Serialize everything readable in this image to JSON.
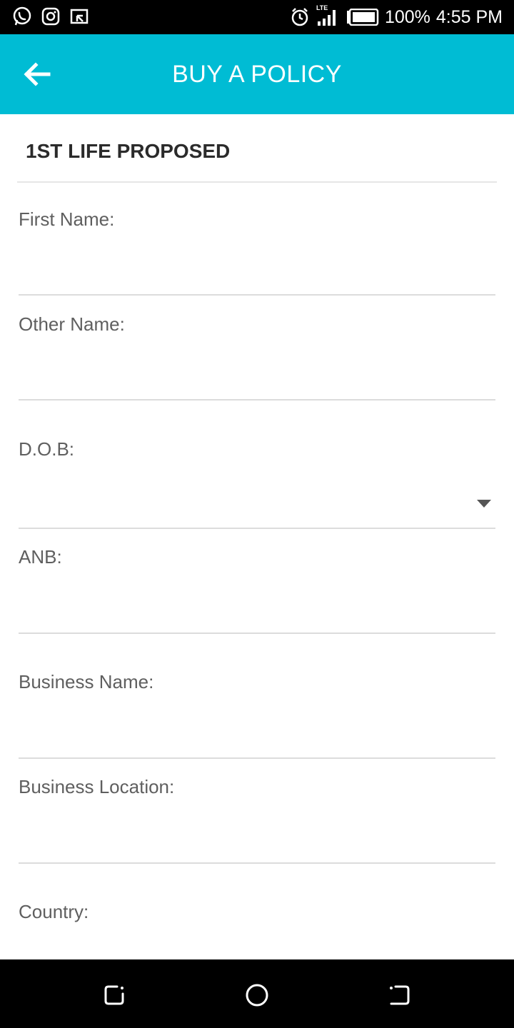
{
  "status_bar": {
    "left_icons": [
      "whatsapp-icon",
      "instagram-icon",
      "cast-icon"
    ],
    "right_icons": [
      "alarm-icon",
      "signal-icon",
      "battery-icon"
    ],
    "network_label": "LTE",
    "battery_percent": "100%",
    "time": "4:55 PM"
  },
  "app_bar": {
    "back_icon": "arrow-left-icon",
    "title": "BUY A POLICY"
  },
  "section": {
    "title": "1ST LIFE PROPOSED"
  },
  "fields": {
    "first_name": {
      "label": "First Name:",
      "value": ""
    },
    "other_name": {
      "label": "Other Name:",
      "value": ""
    },
    "dob": {
      "label": "D.O.B:",
      "value": ""
    },
    "anb": {
      "label": "ANB:",
      "value": ""
    },
    "business_name": {
      "label": "Business Name:",
      "value": ""
    },
    "business_location": {
      "label": "Business Location:",
      "value": ""
    },
    "country": {
      "label": "Country:",
      "value": ""
    }
  },
  "nav_bar": {
    "icons": [
      "recent-apps-icon",
      "home-icon",
      "back-nav-icon"
    ]
  },
  "colors": {
    "app_bar": "#00bcd4",
    "status_bar": "#000000",
    "nav_bar": "#000000"
  }
}
